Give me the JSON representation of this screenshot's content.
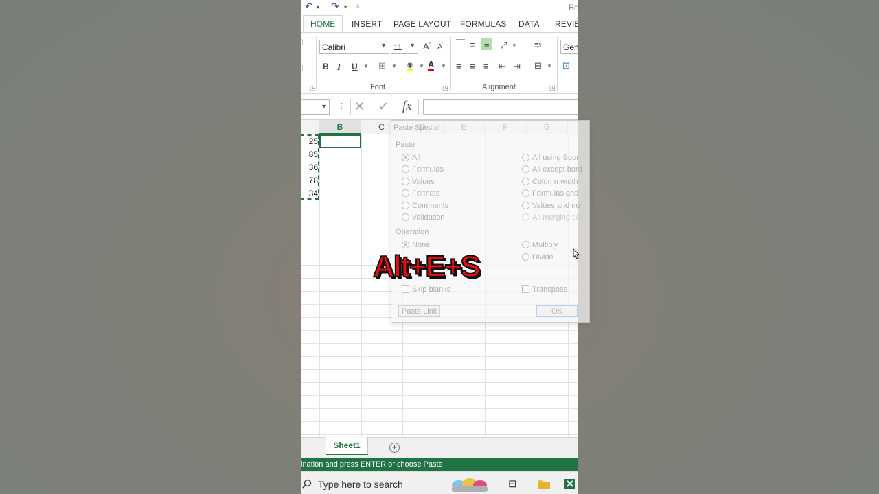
{
  "window": {
    "title": "Bo"
  },
  "ribbon": {
    "tabs": [
      "HOME",
      "INSERT",
      "PAGE LAYOUT",
      "FORMULAS",
      "DATA",
      "REVIEW"
    ],
    "font_name": "Calibri",
    "font_size": "11",
    "number_format": "Gene",
    "groups": {
      "font": "Font",
      "alignment": "Alignment"
    }
  },
  "formula_bar": {
    "cancel": "✕",
    "enter": "✓",
    "fx": "fx",
    "value": ""
  },
  "grid": {
    "columns": [
      "B",
      "C",
      "D",
      "E",
      "F",
      "G"
    ],
    "selected_column": "B",
    "values": [
      "25",
      "85",
      "36",
      "78",
      "34"
    ]
  },
  "paste_special": {
    "title": "Paste Special",
    "paste_label": "Paste",
    "paste_left": [
      "All",
      "Formulas",
      "Values",
      "Formats",
      "Comments",
      "Validation"
    ],
    "paste_right": [
      "All using Sour",
      "All except bord",
      "Column width",
      "Formulas and",
      "Values and nu",
      "All merging co"
    ],
    "operation_label": "Operation",
    "op_none": "None",
    "op_multiply": "Multiply",
    "op_divide": "Divide",
    "skip_blanks": "Skip blanks",
    "transpose": "Transpose",
    "paste_link": "Paste Link",
    "ok": "OK"
  },
  "caption": "Alt+E+S",
  "sheets": {
    "active": "Sheet1",
    "add": "+"
  },
  "status_text": "ination and press ENTER or choose Paste",
  "taskbar": {
    "search_placeholder": "Type here to search"
  },
  "colors": {
    "excel_green": "#217346",
    "caption_red": "#e80c0c"
  }
}
